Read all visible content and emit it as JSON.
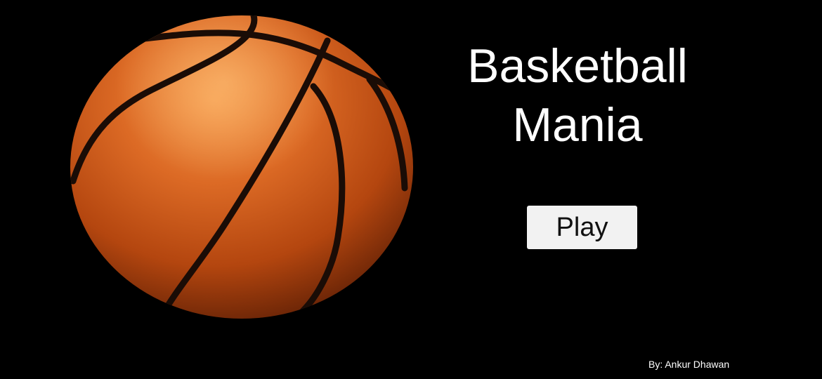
{
  "title": {
    "line1": "Basketball",
    "line2": "Mania"
  },
  "play_button": {
    "label": "Play"
  },
  "credit": "By: Ankur Dhawan",
  "colors": {
    "background": "#000000",
    "ball": "#d4601c",
    "seams": "#1a0c06",
    "button": "#f2f2f2",
    "text": "#ffffff"
  },
  "icons": {
    "hero_image": "basketball"
  }
}
